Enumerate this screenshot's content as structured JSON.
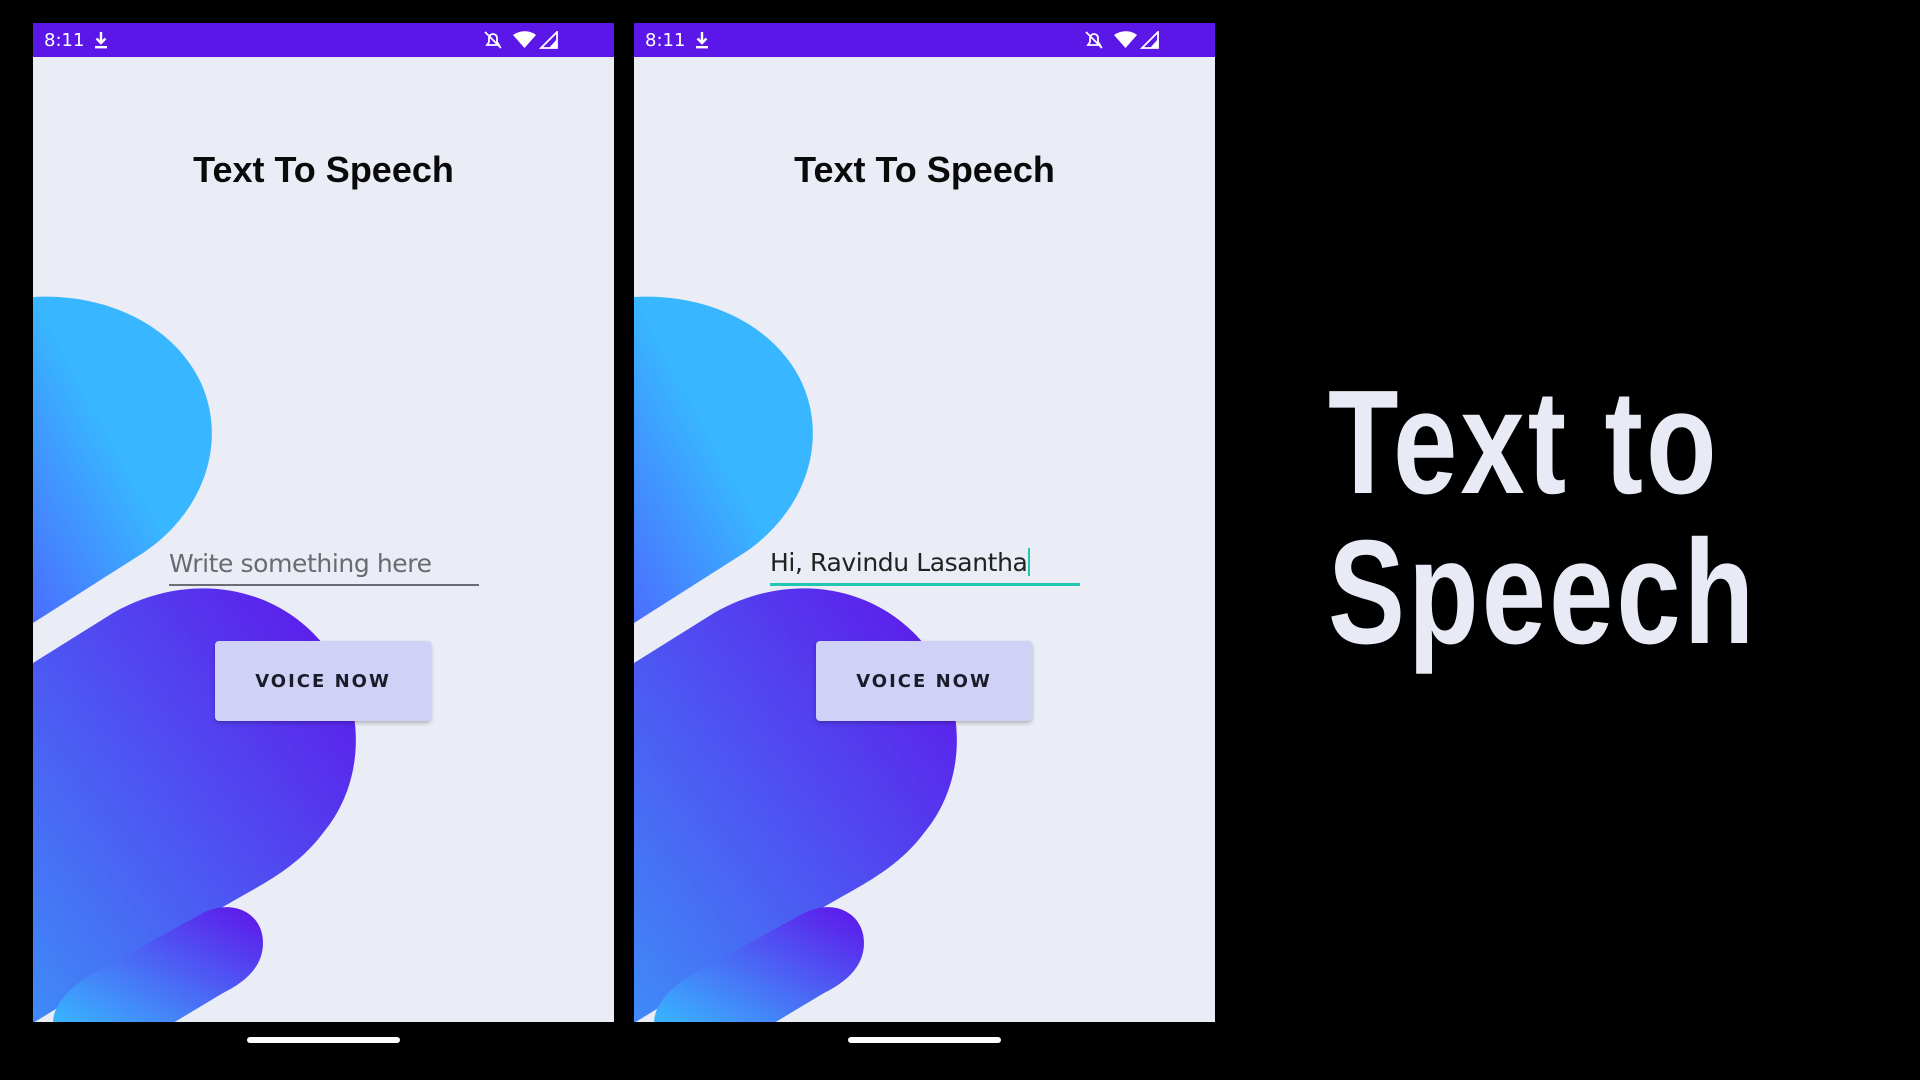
{
  "status_bar": {
    "time": "8:11"
  },
  "app": {
    "title": "Text To Speech",
    "button_label": "VOICE NOW"
  },
  "screens": {
    "left": {
      "input_value": "",
      "input_placeholder": "Write something here"
    },
    "right": {
      "input_value": "Hi, Ravindu Lasantha"
    }
  },
  "promo": {
    "line1": "Text to",
    "line2": "Speech"
  },
  "colors": {
    "status_bar": "#5a17e8",
    "app_background": "#eaecf6",
    "button": "#d0d1f6",
    "focus_underline": "#21c7b1",
    "gradient_cyan": "#38b6ff",
    "gradient_purple": "#5f13ea"
  }
}
